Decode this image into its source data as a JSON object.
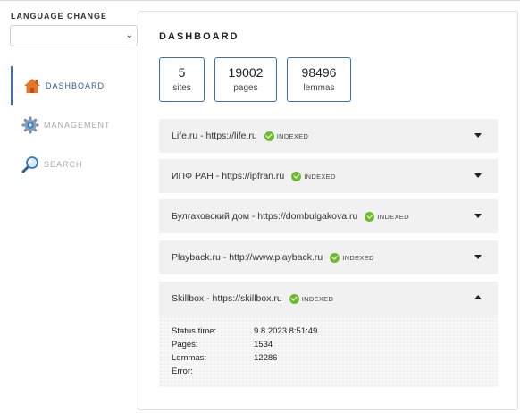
{
  "sidebar": {
    "language_label": "LANGUAGE CHANGE",
    "language_value": "",
    "items": [
      {
        "label": "DASHBOARD",
        "icon": "house-icon",
        "active": true
      },
      {
        "label": "MANAGEMENT",
        "icon": "gear-icon",
        "active": false
      },
      {
        "label": "SEARCH",
        "icon": "magnifier-icon",
        "active": false
      }
    ]
  },
  "main": {
    "title": "DASHBOARD",
    "stats": [
      {
        "value": "5",
        "label": "sites"
      },
      {
        "value": "19002",
        "label": "pages"
      },
      {
        "value": "98496",
        "label": "lemmas"
      }
    ],
    "sites": [
      {
        "name": "Life.ru - https://life.ru",
        "status": "INDEXED",
        "expanded": false
      },
      {
        "name": "ИПФ РАН - https://ipfran.ru",
        "status": "INDEXED",
        "expanded": false
      },
      {
        "name": "Булгаковский дом - https://dombulgakova.ru",
        "status": "INDEXED",
        "expanded": false
      },
      {
        "name": "Playback.ru - http://www.playback.ru",
        "status": "INDEXED",
        "expanded": false
      },
      {
        "name": "Skillbox - https://skillbox.ru",
        "status": "INDEXED",
        "expanded": true
      }
    ],
    "details": {
      "status_time_label": "Status time:",
      "status_time": "9.8.2023 8:51:49",
      "pages_label": "Pages:",
      "pages": "1534",
      "lemmas_label": "Lemmas:",
      "lemmas": "12286",
      "error_label": "Error:",
      "error": ""
    }
  },
  "colors": {
    "accent": "#3b6fb6",
    "indexed": "#6cbb2c",
    "row_bg": "#f2f1f2"
  }
}
